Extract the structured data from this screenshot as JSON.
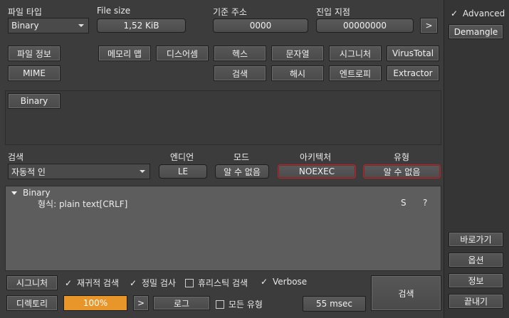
{
  "file_type": {
    "label": "파일 타입",
    "value": "Binary"
  },
  "file_size": {
    "label": "File size",
    "value": "1,52 KiB"
  },
  "base_address": {
    "label": "기준 주소",
    "value": "0000"
  },
  "entry_point": {
    "label": "진입 지점",
    "value": "00000000",
    "go": ">"
  },
  "buttons": {
    "file_info": "파일 정보",
    "mime": "MIME",
    "memory_map": "메모리 맵",
    "disasm": "디스어셈",
    "hex": "헥스",
    "strings": "문자열",
    "signatures": "시그니처",
    "virustotal": "VirusTotal",
    "search": "검색",
    "hash": "해시",
    "entropy": "엔트로피",
    "extractor": "Extractor"
  },
  "tag": "Binary",
  "scan": {
    "search_label": "검색",
    "search_value": "자동적 인",
    "endian_label": "엔디언",
    "endian_value": "LE",
    "mode_label": "모드",
    "mode_value": "알 수 없음",
    "arch_label": "아키텍처",
    "arch_value": "NOEXEC",
    "type_label": "유형",
    "type_value": "알 수 없음"
  },
  "result": {
    "node": "Binary",
    "format": "형식: plain text[CRLF]",
    "col_s": "S",
    "col_q": "?"
  },
  "bottom": {
    "signatures": "시그니처",
    "recursive": "재귀적 검색",
    "deep": "정밀 검사",
    "heuristic": "휴리스틱 검색",
    "verbose": "Verbose",
    "directory": "디렉토리",
    "progress": "100%",
    "progress_value": 100,
    "next": ">",
    "log": "로그",
    "all_types": "모든 유형",
    "time": "55 msec",
    "scan": "검색"
  },
  "sidebar": {
    "advanced": "Advanced",
    "demangle": "Demangle",
    "goto": "바로가기",
    "options": "옵션",
    "about": "정보",
    "exit": "끝내기"
  },
  "colors": {
    "background": "#3c3c3c",
    "accent_orange": "#e8962a",
    "error_red": "#b0282c",
    "info_panel": "#5d5d5d"
  }
}
